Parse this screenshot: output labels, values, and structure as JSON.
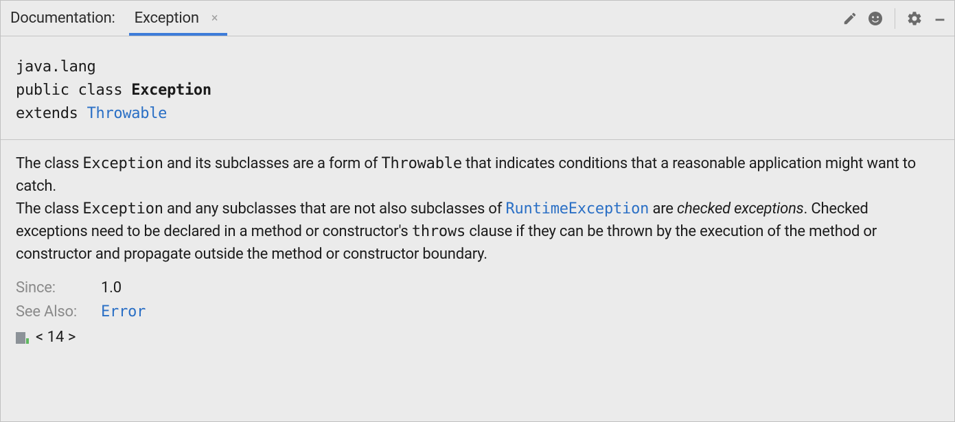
{
  "header": {
    "title": "Documentation:",
    "tab_label": "Exception"
  },
  "signature": {
    "package": "java.lang",
    "modifiers": "public class",
    "class_name": "Exception",
    "extends_kw": "extends",
    "super_class": "Throwable"
  },
  "body": {
    "p1_a": "The class ",
    "p1_b": "Exception",
    "p1_c": " and its subclasses are a form of ",
    "p1_d": "Throwable",
    "p1_e": " that indicates conditions that a reasonable application might want to catch.",
    "p2_a": "The class ",
    "p2_b": "Exception",
    "p2_c": " and any subclasses that are not also subclasses of ",
    "p2_d": "RuntimeException",
    "p2_e": " are ",
    "p2_f": "checked exceptions",
    "p2_g": ". Checked exceptions need to be declared in a method or constructor's ",
    "p2_h": "throws",
    "p2_i": " clause if they can be thrown by the execution of the method or constructor and propagate outside the method or constructor boundary."
  },
  "meta": {
    "since_label": "Since:",
    "since_value": "1.0",
    "see_also_label": "See Also:",
    "see_also_value": "Error"
  },
  "footer": {
    "jdk_version": "< 14 >"
  }
}
